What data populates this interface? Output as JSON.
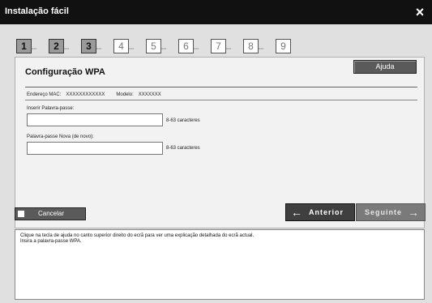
{
  "window": {
    "title": "Instalação fácil",
    "close_label": "×"
  },
  "steps": [
    {
      "number": "1",
      "state": "done"
    },
    {
      "number": "2",
      "state": "done"
    },
    {
      "number": "3",
      "state": "done"
    },
    {
      "number": "4",
      "state": "todo"
    },
    {
      "number": "5",
      "state": "todo"
    },
    {
      "number": "6",
      "state": "todo"
    },
    {
      "number": "7",
      "state": "todo"
    },
    {
      "number": "8",
      "state": "todo"
    },
    {
      "number": "9",
      "state": "todo"
    }
  ],
  "panel": {
    "title": "Configuração WPA",
    "help_label": "Ajuda",
    "mac_label": "Endereço MAC:",
    "mac_value": "XXXXXXXXXXXX",
    "model_label": "Modelo:",
    "model_value": "XXXXXXX"
  },
  "form": {
    "passphrase_label": "Inserir Palavra-passe:",
    "passphrase_value": "",
    "passphrase_hint": "8-63 caracteres",
    "new_passphrase_label": "Palavra-passe Nova (de novo):",
    "new_passphrase_value": "",
    "new_passphrase_hint": "8-63 caracteres"
  },
  "buttons": {
    "cancel": "Cancelar",
    "previous": "Anterior",
    "next": "Seguinte"
  },
  "info": {
    "line1": "Clique na tecla de ajuda no canto superior direito do ecrã para ver uma explicação detalhada do ecrã actual.",
    "line2": "Insira a palavra-passe WPA."
  }
}
